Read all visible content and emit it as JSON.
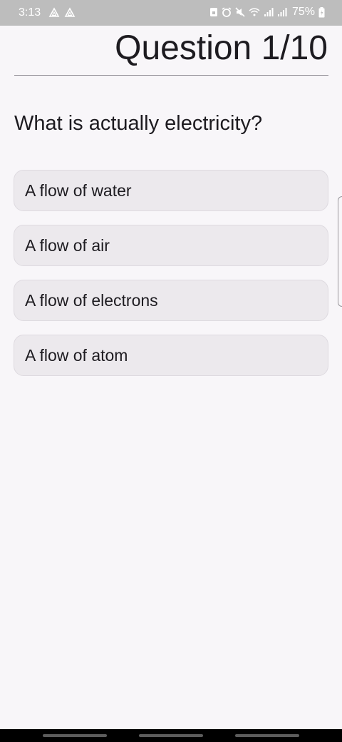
{
  "status_bar": {
    "time": "3:13",
    "battery": "75%",
    "left_icons": [
      "drive-icon",
      "drive-icon"
    ],
    "right_icons": [
      "sim-lock-icon",
      "alarm-icon",
      "mute-icon",
      "wifi-icon",
      "signal-icon",
      "signal-icon",
      "battery-icon"
    ]
  },
  "header": {
    "title": "Question 1/10"
  },
  "question": {
    "text": "What is actually electricity?"
  },
  "answers": [
    {
      "label": "A flow of water"
    },
    {
      "label": "A flow of air"
    },
    {
      "label": "A flow of electrons"
    },
    {
      "label": "A flow of atom"
    }
  ]
}
